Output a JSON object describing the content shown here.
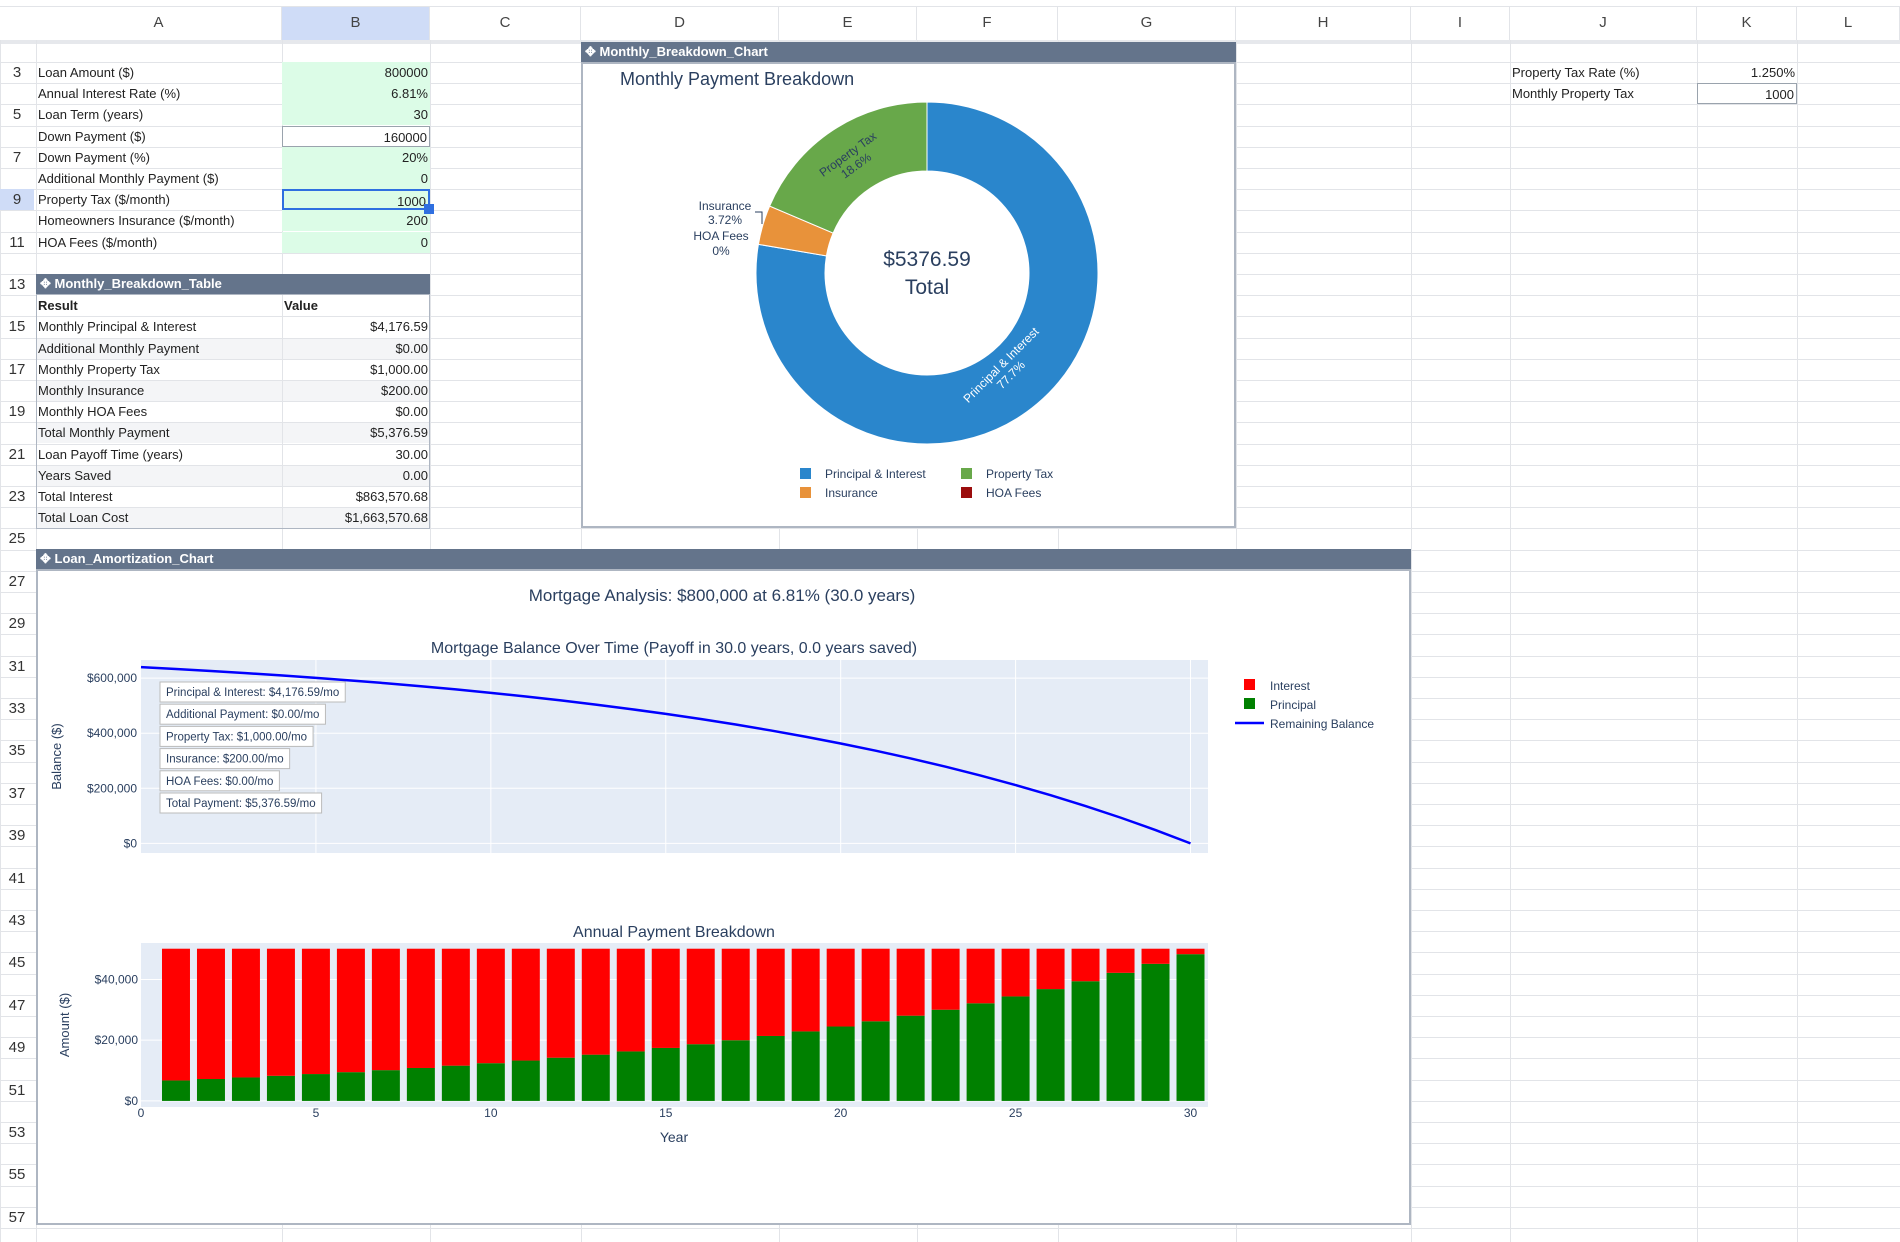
{
  "sheet": {
    "columns": [
      "A",
      "B",
      "C",
      "D",
      "E",
      "F",
      "G",
      "H",
      "I",
      "J",
      "K",
      "L"
    ],
    "selected_column": "B",
    "row_numbers": [
      "3",
      "5",
      "7",
      "9",
      "11",
      "13",
      "15",
      "17",
      "19",
      "21",
      "23",
      "25",
      "27",
      "29",
      "31",
      "33",
      "35",
      "37",
      "39",
      "41",
      "43",
      "45",
      "47",
      "49",
      "51",
      "53",
      "55",
      "57"
    ],
    "selected_row": "9"
  },
  "inputs": [
    {
      "label": "Loan Amount ($)",
      "value": "800000"
    },
    {
      "label": "Annual Interest Rate (%)",
      "value": "6.81%"
    },
    {
      "label": "Loan Term (years)",
      "value": "30"
    },
    {
      "label": "Down Payment ($)",
      "value": "160000"
    },
    {
      "label": "Down Payment (%)",
      "value": "20%"
    },
    {
      "label": "Additional Monthly Payment ($)",
      "value": "0"
    },
    {
      "label": "Property Tax ($/month)",
      "value": "1000"
    },
    {
      "label": "Homeowners Insurance ($/month)",
      "value": "200"
    },
    {
      "label": "HOA Fees ($/month)",
      "value": "0"
    }
  ],
  "side_inputs": [
    {
      "label": "Property Tax Rate (%)",
      "value": "1.250%"
    },
    {
      "label": "Monthly Property Tax",
      "value": "1000"
    }
  ],
  "table": {
    "title": "Monthly_Breakdown_Table",
    "headers": [
      "Result",
      "Value"
    ],
    "rows": [
      [
        "Monthly Principal & Interest",
        "$4,176.59"
      ],
      [
        "Additional Monthly Payment",
        "$0.00"
      ],
      [
        "Monthly Property Tax",
        "$1,000.00"
      ],
      [
        "Monthly Insurance",
        "$200.00"
      ],
      [
        "Monthly HOA Fees",
        "$0.00"
      ],
      [
        "Total Monthly Payment",
        "$5,376.59"
      ],
      [
        "Loan Payoff Time (years)",
        "30.00"
      ],
      [
        "Years Saved",
        "0.00"
      ],
      [
        "Total Interest",
        "$863,570.68"
      ],
      [
        "Total Loan Cost",
        "$1,663,570.68"
      ]
    ]
  },
  "chart_data": [
    {
      "object_name": "Monthly_Breakdown_Chart",
      "type": "pie",
      "title": "Monthly Payment Breakdown",
      "center_text": [
        "$5376.59",
        "Total"
      ],
      "slices": [
        {
          "label": "Principal & Interest",
          "value": 4176.59,
          "percent": "77.7%",
          "color": "#2a86cc"
        },
        {
          "label": "Insurance",
          "value": 200,
          "percent": "3.72%",
          "color": "#e8923a"
        },
        {
          "label": "HOA Fees",
          "value": 0,
          "percent": "0%",
          "color": "#9b0d0d"
        },
        {
          "label": "Property Tax",
          "value": 1000,
          "percent": "18.6%",
          "color": "#68a84a"
        }
      ],
      "legend": [
        "Principal & Interest",
        "Property Tax",
        "Insurance",
        "HOA Fees"
      ],
      "legend_colors": [
        "#2a86cc",
        "#68a84a",
        "#e8923a",
        "#9b0d0d"
      ]
    },
    {
      "object_name": "Loan_Amortization_Chart",
      "main_title": "Mortgage Analysis: $800,000 at 6.81% (30.0 years)",
      "type": "line",
      "title": "Mortgage Balance Over Time (Payoff in 30.0 years, 0.0 years saved)",
      "ylabel": "Balance ($)",
      "yticks": [
        0,
        200000,
        400000,
        600000
      ],
      "ytick_labels": [
        "$0",
        "$200,000",
        "$400,000",
        "$600,000"
      ],
      "xlim": [
        0,
        30.5
      ],
      "ylim": [
        -35000,
        666000
      ],
      "x": [
        0,
        1,
        2,
        3,
        4,
        5,
        6,
        7,
        8,
        9,
        10,
        11,
        12,
        13,
        14,
        15,
        16,
        17,
        18,
        19,
        20,
        21,
        22,
        23,
        24,
        25,
        26,
        27,
        28,
        29,
        30
      ],
      "balance": [
        640000,
        633257,
        626040,
        618316,
        610050,
        601203,
        591734,
        581600,
        570754,
        559146,
        546722,
        533425,
        519194,
        503963,
        487662,
        470215,
        451542,
        431557,
        410168,
        387276,
        362775,
        336553,
        308488,
        278451,
        246304,
        211898,
        175074,
        135663,
        93483,
        48339,
        0
      ],
      "line_color": "#0000ff",
      "annotations": [
        "Principal & Interest: $4,176.59/mo",
        "Additional Payment: $0.00/mo",
        "Property Tax: $1,000.00/mo",
        "Insurance: $200.00/mo",
        "HOA Fees: $0.00/mo",
        "Total Payment: $5,376.59/mo"
      ],
      "legend": [
        {
          "label": "Interest",
          "color": "#ff0000"
        },
        {
          "label": "Principal",
          "color": "#008000"
        },
        {
          "label": "Remaining Balance",
          "color": "#0000ff"
        }
      ]
    },
    {
      "type": "bar",
      "stacked": true,
      "title": "Annual Payment Breakdown",
      "xlabel": "Year",
      "ylabel": "Amount ($)",
      "xticks": [
        0,
        5,
        10,
        15,
        20,
        25,
        30
      ],
      "yticks": [
        0,
        20000,
        40000
      ],
      "ytick_labels": [
        "$0",
        "$20,000",
        "$40,000"
      ],
      "xlim": [
        0,
        30.5
      ],
      "ylim": [
        -2000,
        52000
      ],
      "years": [
        1,
        2,
        3,
        4,
        5,
        6,
        7,
        8,
        9,
        10,
        11,
        12,
        13,
        14,
        15,
        16,
        17,
        18,
        19,
        20,
        21,
        22,
        23,
        24,
        25,
        26,
        27,
        28,
        29,
        30
      ],
      "annual_total": 50119,
      "principal": [
        6743,
        7217,
        7724,
        8266,
        8847,
        9469,
        10134,
        10846,
        11608,
        12424,
        13297,
        14231,
        15231,
        16301,
        17447,
        18673,
        19985,
        21389,
        22892,
        24501,
        26222,
        28065,
        30037,
        32147,
        34406,
        36824,
        39411,
        42180,
        45144,
        48316
      ],
      "principal_color": "#008000",
      "interest_color": "#ff0000"
    }
  ]
}
